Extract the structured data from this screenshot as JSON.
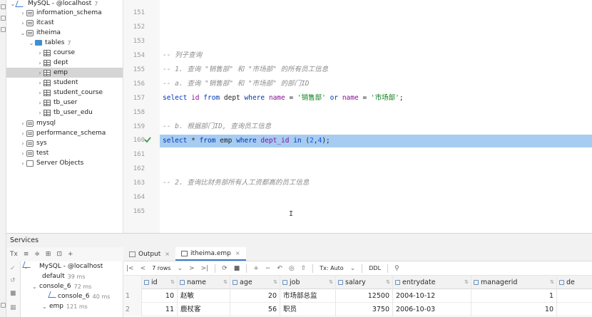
{
  "db_tree": {
    "root": {
      "label": "MySQL - @localhost",
      "count": "7"
    },
    "items": [
      {
        "label": "information_schema"
      },
      {
        "label": "itcast"
      },
      {
        "label": "itheima"
      },
      {
        "label": "tables",
        "count": "7"
      },
      {
        "label": "course"
      },
      {
        "label": "dept"
      },
      {
        "label": "emp"
      },
      {
        "label": "student"
      },
      {
        "label": "student_course"
      },
      {
        "label": "tb_user"
      },
      {
        "label": "tb_user_edu"
      },
      {
        "label": "mysql"
      },
      {
        "label": "performance_schema"
      },
      {
        "label": "sys"
      },
      {
        "label": "test"
      },
      {
        "label": "Server Objects"
      }
    ]
  },
  "editor": {
    "line_numbers": [
      "151",
      "152",
      "153",
      "154",
      "155",
      "156",
      "157",
      "158",
      "159",
      "160",
      "161",
      "162",
      "163",
      "164",
      "165"
    ],
    "lines": {
      "l154": "-- 列子查询",
      "l155": "-- 1. 查询 \"销售部\" 和 \"市场部\" 的所有员工信息",
      "l156": "-- a. 查询 \"销售部\" 和 \"市场部\" 的部门ID",
      "l157": {
        "kw1": "select",
        "c1": "id",
        "kw2": "from",
        "t1": "dept",
        "kw3": "where",
        "c2": "name",
        "op1": "=",
        "s1": "'销售部'",
        "kw4": "or",
        "c3": "name",
        "op2": "=",
        "s2": "'市场部'",
        "end": ";"
      },
      "l159": "-- b. 根据部门ID, 查询员工信息",
      "l160": {
        "kw1": "select",
        "star": "*",
        "kw2": "from",
        "t1": "emp",
        "kw3": "where",
        "c1": "dept_id",
        "kw4": "in",
        "open": "(",
        "n1": "2",
        "comma": ",",
        "n2": "4",
        "close": ");"
      },
      "l164": "-- 2. 查询比财务部所有人工资都高的员工信息"
    }
  },
  "services": {
    "title": "Services",
    "toolbar": {
      "tx_label": "Tx"
    },
    "tree": [
      {
        "label": "MySQL - @localhost",
        "ms": ""
      },
      {
        "label": "default",
        "ms": "39 ms"
      },
      {
        "label": "console_6",
        "ms": "72 ms"
      },
      {
        "label": "console_6",
        "ms": "40 ms"
      },
      {
        "label": "emp",
        "ms": "121 ms"
      }
    ]
  },
  "results": {
    "tabs": [
      {
        "label": "Output"
      },
      {
        "label": "itheima.emp"
      }
    ],
    "toolbar": {
      "rows_label": "7 rows",
      "tx_label": "Tx: Auto",
      "ddl_label": "DDL"
    },
    "columns": [
      "id",
      "name",
      "age",
      "job",
      "salary",
      "entrydate",
      "managerid",
      "de"
    ],
    "rows": [
      {
        "num": "1",
        "id": "10",
        "name": "赵敏",
        "age": "20",
        "job": "市场部总监",
        "salary": "12500",
        "entrydate": "2004-10-12",
        "managerid": "1"
      },
      {
        "num": "2",
        "id": "11",
        "name": "鹿杖客",
        "age": "56",
        "job": "职员",
        "salary": "3750",
        "entrydate": "2006-10-03",
        "managerid": "10"
      }
    ]
  },
  "colors": {
    "selection": "#a6ccf2",
    "keyword": "#0033b3",
    "string": "#067d17",
    "comment": "#8c8c8c",
    "accent": "#3d7ac8"
  }
}
